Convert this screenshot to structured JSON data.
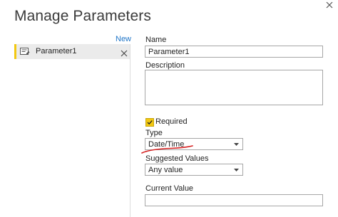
{
  "dialog": {
    "title": "Manage Parameters"
  },
  "left_panel": {
    "new_label": "New",
    "parameters": [
      {
        "label": "Parameter1"
      }
    ]
  },
  "form": {
    "name_label": "Name",
    "name_value": "Parameter1",
    "description_label": "Description",
    "description_value": "",
    "required_label": "Required",
    "required_checked": true,
    "type_label": "Type",
    "type_value": "Date/Time",
    "suggested_values_label": "Suggested Values",
    "suggested_values_value": "Any value",
    "current_value_label": "Current Value",
    "current_value_value": ""
  },
  "colors": {
    "accent": "#f2c811",
    "link": "#1e74c7",
    "annotation": "#d62020"
  },
  "icons": [
    "close-icon",
    "parameter-icon",
    "delete-icon",
    "check-icon",
    "chevron-down-icon"
  ]
}
